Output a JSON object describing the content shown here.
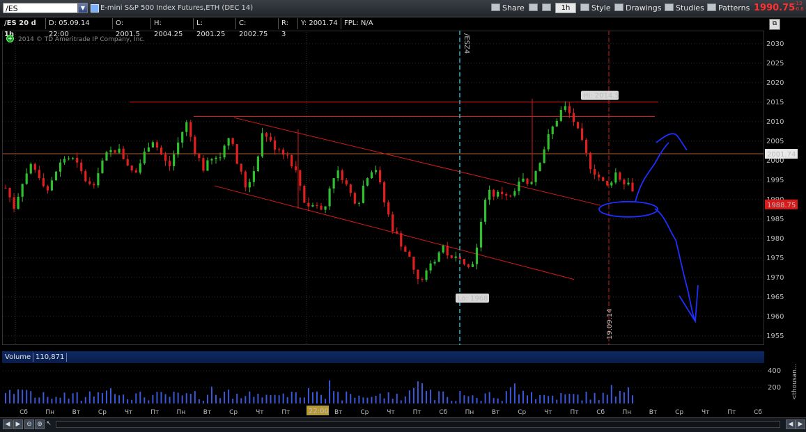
{
  "toolbar": {
    "symbol": "/ES",
    "description": "E-mini S&P 500 Index Futures,ETH (DEC 14)",
    "share": "Share",
    "interval": "1h",
    "style": "Style",
    "drawings": "Drawings",
    "studies": "Studies",
    "patterns": "Patterns",
    "last_price": "1990.75",
    "net_change_1": "-13",
    "net_change_2": "-0.6"
  },
  "info_bar": {
    "title": "/ES 20 d 1h",
    "date": "D: 05.09.14 22:00",
    "open": "O: 2001.5",
    "high": "H: 2004.25",
    "low": "L: 2001.25",
    "close": "C: 2002.75",
    "range": "R: 3",
    "y": "Y: 2001.74",
    "fpl": "FPL: N/A"
  },
  "copyright": "2014 © TD Ameritrade IP Company, Inc.",
  "chart_data": {
    "type": "candlestick",
    "ylim": [
      1953,
      2033
    ],
    "y_ticks": [
      "2030",
      "2025",
      "2020",
      "2015",
      "2010",
      "2005",
      "2000",
      "1995",
      "1990",
      "1985",
      "1980",
      "1975",
      "1970",
      "1965",
      "1960",
      "1955"
    ],
    "annotations": {
      "hi": "Hi: 2014.5",
      "lo": "Lo: 1968",
      "expiry_label": "/ESZ4",
      "date_marker": "19.09.14",
      "price_bubble": "2001.74",
      "last_bubble": "1988.75"
    },
    "hi_value": 2014.5,
    "lo_value": 1968,
    "horizontal_lines": [
      2001.74,
      2015.0,
      2011.3
    ],
    "price_path": [
      1993,
      1988,
      1995,
      1999,
      1996,
      1992,
      1998,
      2001,
      2000,
      1996,
      1993,
      1999,
      2002,
      2003,
      2000,
      1996,
      2001,
      2006,
      2002,
      1998,
      2004,
      2010,
      2003,
      1998,
      2000,
      2001,
      2007,
      1999,
      1993,
      1998,
      2008,
      2004,
      2003,
      2001,
      1996,
      1988,
      1990,
      1986,
      1996,
      1997,
      1992,
      1989,
      1996,
      1999,
      1990,
      1983,
      1979,
      1975,
      1969,
      1971,
      1975,
      1978,
      1974,
      1976,
      1972,
      1978,
      1993,
      1991,
      1992,
      1990,
      1995,
      1994,
      1999,
      2005,
      2010,
      2014,
      2011,
      2005,
      1999,
      1996,
      1993,
      1997,
      1995,
      1993
    ],
    "volume_label": "Volume",
    "volume_value": "110,871",
    "volume_ticks": [
      "400",
      "200"
    ],
    "volume_unit": "<thousan...",
    "x_labels": [
      "Сб",
      "Пн",
      "Вт",
      "Ср",
      "Чт",
      "Пт",
      "Пн",
      "Вт",
      "Ср",
      "Чт",
      "Пт",
      "Пн",
      "Вт",
      "Ср",
      "Чт",
      "Пт",
      "Сб",
      "Пн",
      "Вт",
      "Ср",
      "Чт",
      "Пт",
      "Сб",
      "Пн",
      "Вт",
      "Ср",
      "Чт",
      "Пт",
      "Сб"
    ],
    "cursor_time": "22:00"
  },
  "colors": {
    "up": "#2fbf2f",
    "down": "#e02020",
    "trendline": "#d21a1a",
    "drawing": "#1f2fff",
    "expiry": "#29c7d6",
    "last_bubble": "#d91a1a"
  }
}
